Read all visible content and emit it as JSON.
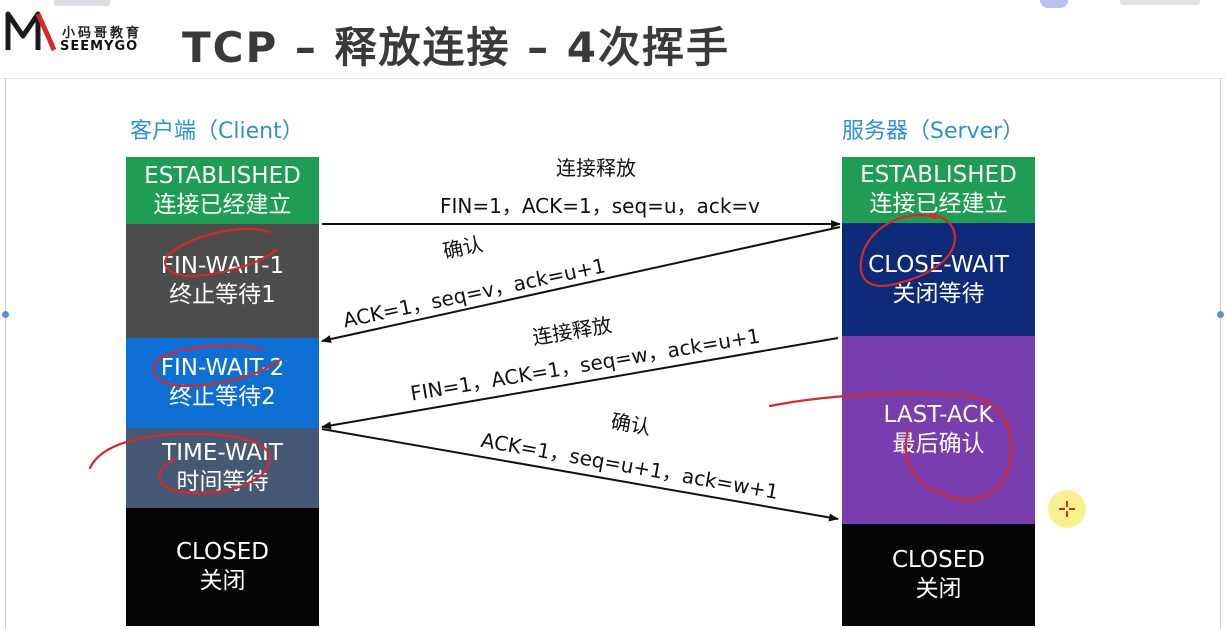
{
  "header": {
    "logo_cn": "小码哥教育",
    "logo_en": "SEEMYGO",
    "title": "TCP – 释放连接 – 4次挥手"
  },
  "client": {
    "label": "客户端（Client）",
    "states": [
      {
        "en": "ESTABLISHED",
        "cn": "连接已经建立",
        "color": "#1f9d55"
      },
      {
        "en": "FIN-WAIT-1",
        "cn": "终止等待1",
        "color": "#4d4d4d"
      },
      {
        "en": "FIN-WAIT-2",
        "cn": "终止等待2",
        "color": "#0d6fd3"
      },
      {
        "en": "TIME-WAIT",
        "cn": "时间等待",
        "color": "#455875"
      },
      {
        "en": "CLOSED",
        "cn": "关闭",
        "color": "#050505"
      }
    ]
  },
  "server": {
    "label": "服务器（Server）",
    "states": [
      {
        "en": "ESTABLISHED",
        "cn": "连接已经建立",
        "color": "#1f9d55"
      },
      {
        "en": "CLOSE-WAIT",
        "cn": "关闭等待",
        "color": "#0c2a78"
      },
      {
        "en": "LAST-ACK",
        "cn": "最后确认",
        "color": "#7a3db0"
      },
      {
        "en": "CLOSED",
        "cn": "关闭",
        "color": "#050505"
      }
    ]
  },
  "messages": [
    {
      "title": "连接释放",
      "detail": "FIN=1，ACK=1，seq=u，ack=v"
    },
    {
      "title": "确认",
      "detail": "ACK=1，seq=v，ack=u+1"
    },
    {
      "title": "连接释放",
      "detail": "FIN=1，ACK=1，seq=w，ack=u+1"
    },
    {
      "title": "确认",
      "detail": "ACK=1，seq=u+1，ack=w+1"
    }
  ],
  "colors": {
    "label_blue": "#2e8fd6",
    "annotation_red": "#d42a2a",
    "title_gray": "#3a3a3a"
  }
}
